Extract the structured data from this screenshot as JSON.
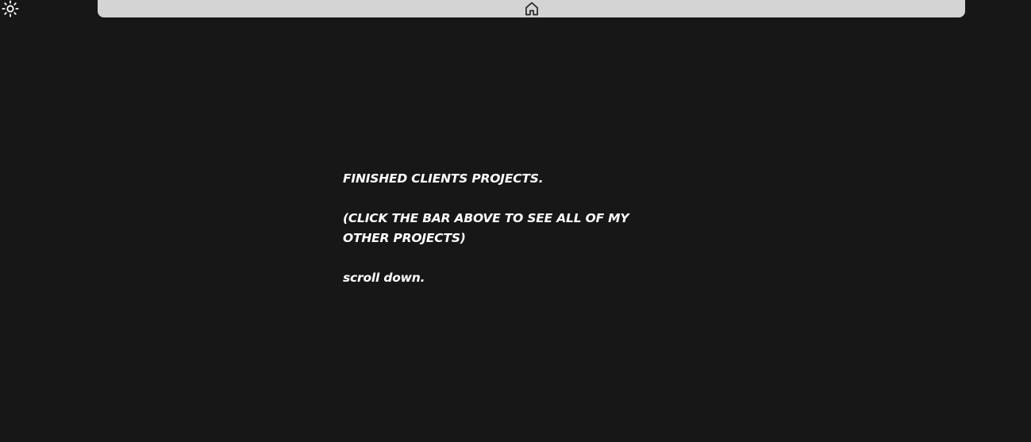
{
  "icons": {
    "theme_toggle": "sun-icon",
    "nav_home": "home-icon"
  },
  "colors": {
    "background": "#171717",
    "bar": "#d4d4d4",
    "text": "#ffffff",
    "icon_dark": "#222222"
  },
  "intro": {
    "heading": "FINISHED CLIENTS PROJECTS.",
    "instruction": "(CLICK THE BAR ABOVE TO SEE ALL OF MY OTHER PROJECTS)",
    "scroll_hint": "scroll down."
  }
}
